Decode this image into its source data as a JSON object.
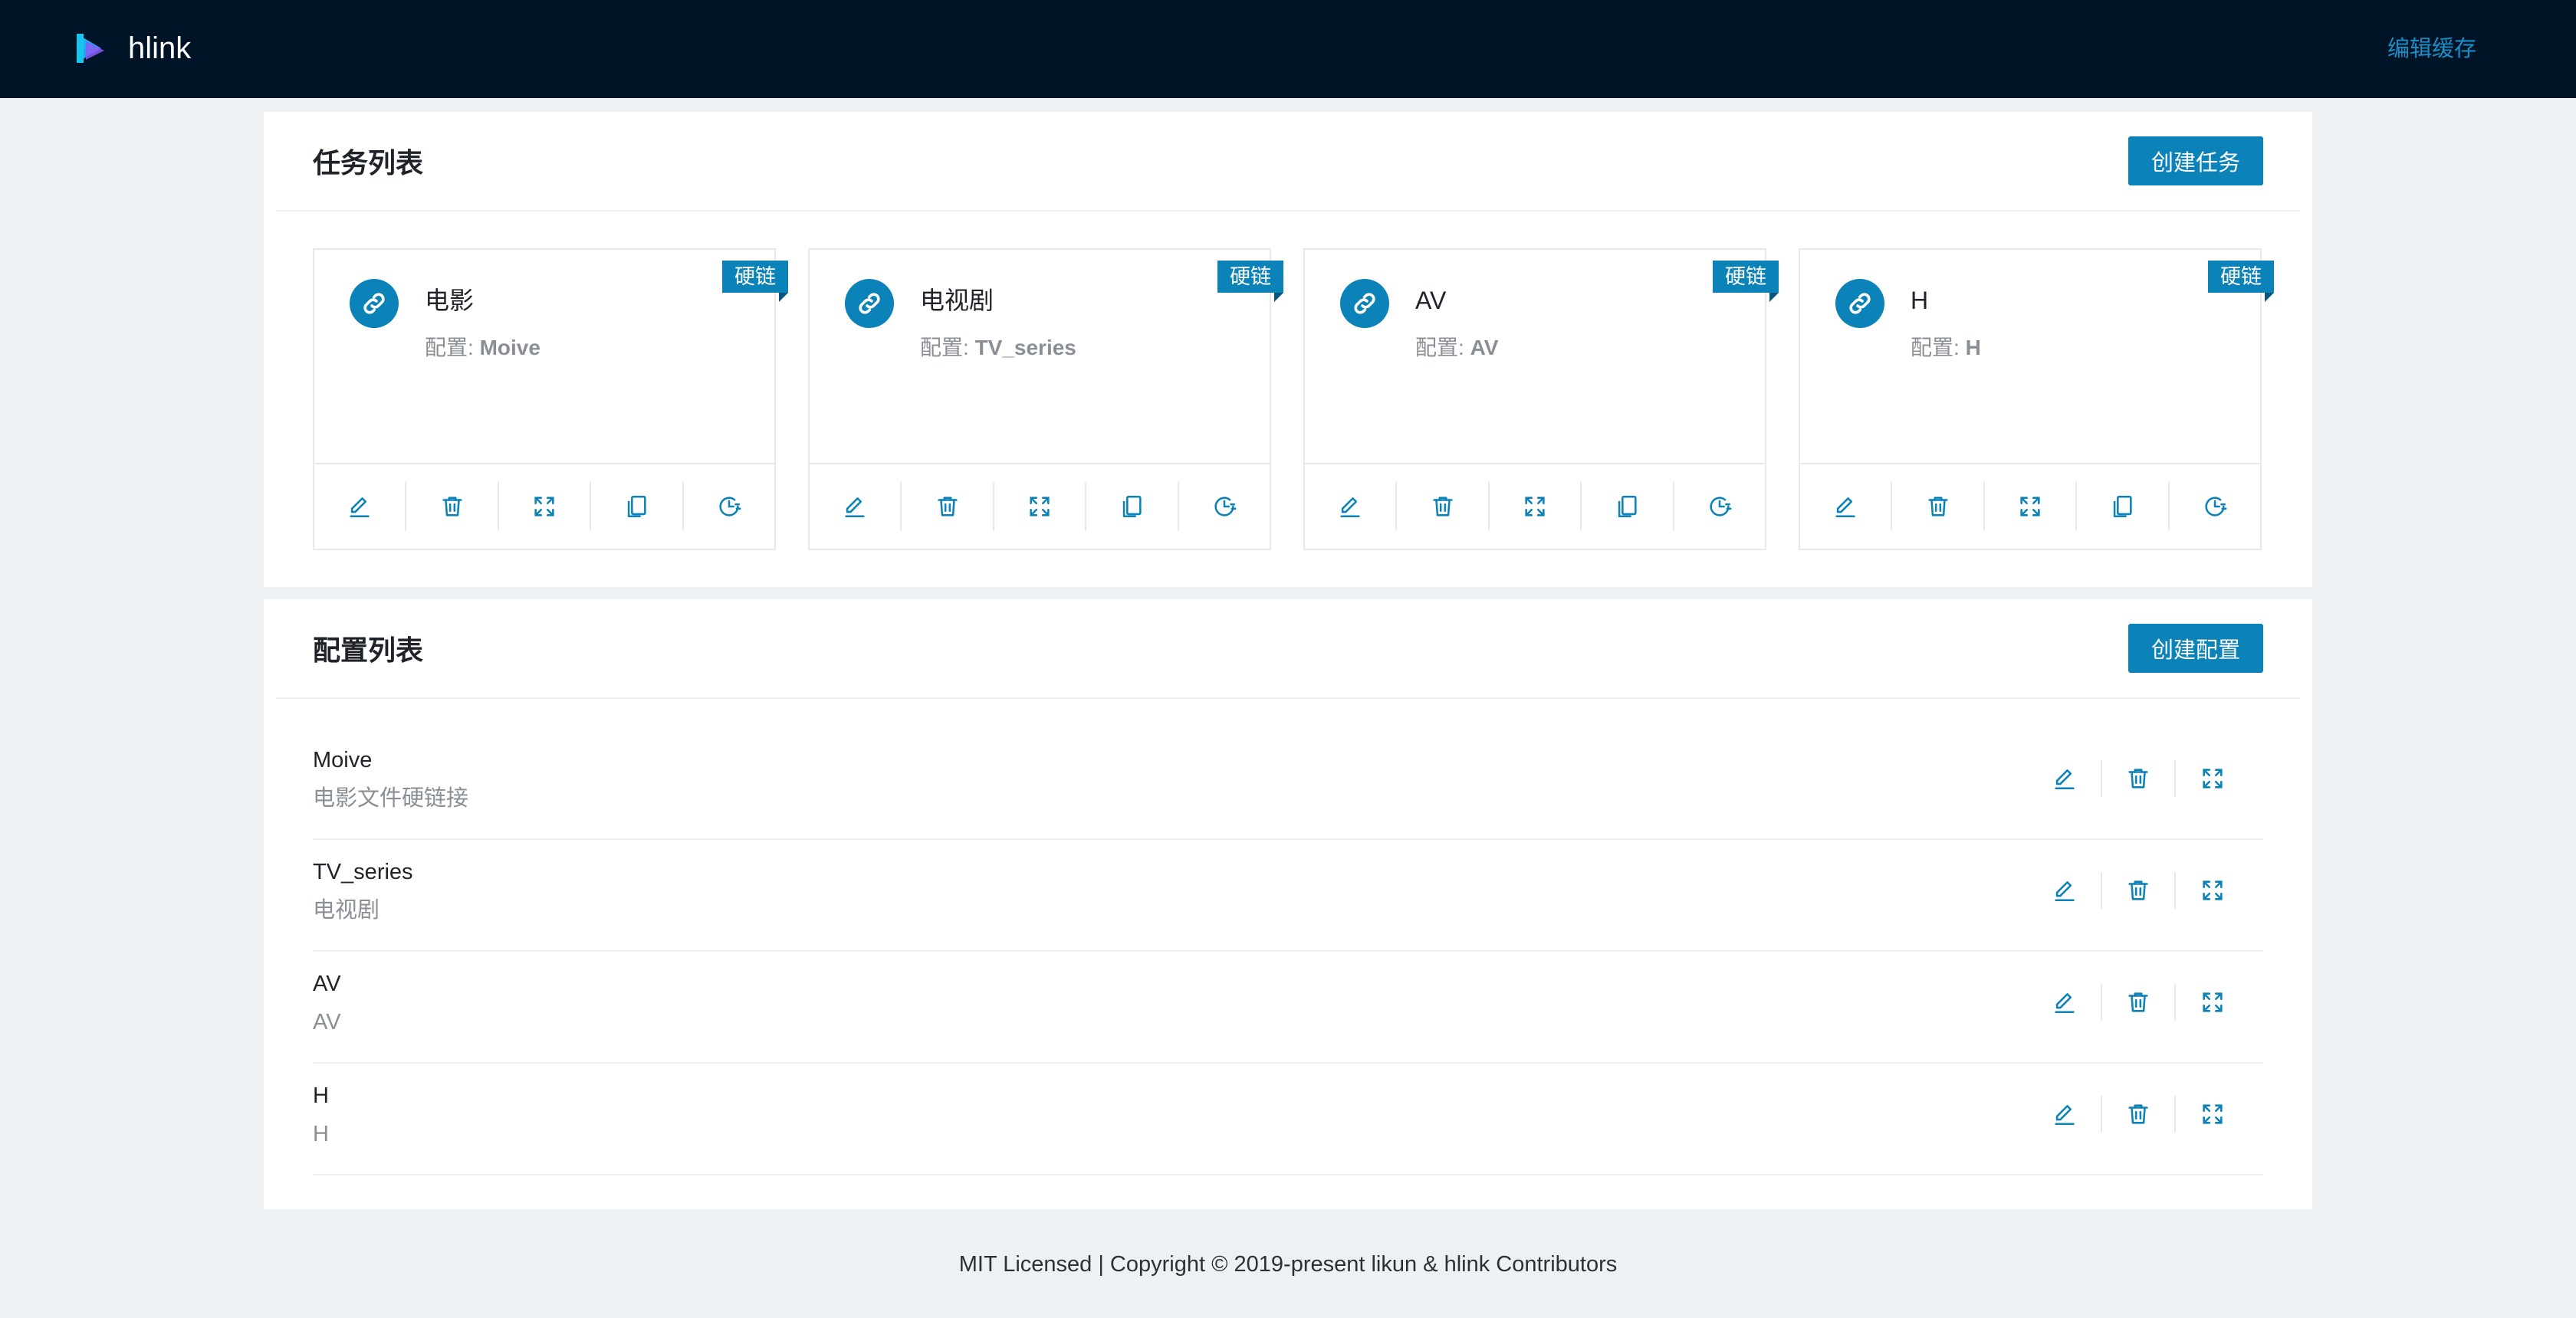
{
  "header": {
    "brand": "hlink",
    "edit_cache": "编辑缓存"
  },
  "tasks": {
    "title": "任务列表",
    "create_label": "创建任务",
    "cards": [
      {
        "name": "电影",
        "config_label": "配置:",
        "config": "Moive",
        "badge": "硬链"
      },
      {
        "name": "电视剧",
        "config_label": "配置:",
        "config": "TV_series",
        "badge": "硬链"
      },
      {
        "name": "AV",
        "config_label": "配置:",
        "config": "AV",
        "badge": "硬链"
      },
      {
        "name": "H",
        "config_label": "配置:",
        "config": "H",
        "badge": "硬链"
      }
    ],
    "card_actions": [
      "edit-icon",
      "trash-icon",
      "expand-icon",
      "copy-icon",
      "schedule-icon"
    ]
  },
  "configs": {
    "title": "配置列表",
    "create_label": "创建配置",
    "rows": [
      {
        "name": "Moive",
        "desc": "电影文件硬链接"
      },
      {
        "name": "TV_series",
        "desc": "电视剧"
      },
      {
        "name": "AV",
        "desc": "AV"
      },
      {
        "name": "H",
        "desc": "H"
      }
    ],
    "row_actions": [
      "edit-icon",
      "trash-icon",
      "expand-icon"
    ]
  },
  "footer": {
    "text": "MIT Licensed | Copyright © 2019-present likun & hlink Contributors"
  },
  "colors": {
    "header_bg": "#001428",
    "accent": "#0b82b8",
    "page_bg": "#eef1f4"
  }
}
